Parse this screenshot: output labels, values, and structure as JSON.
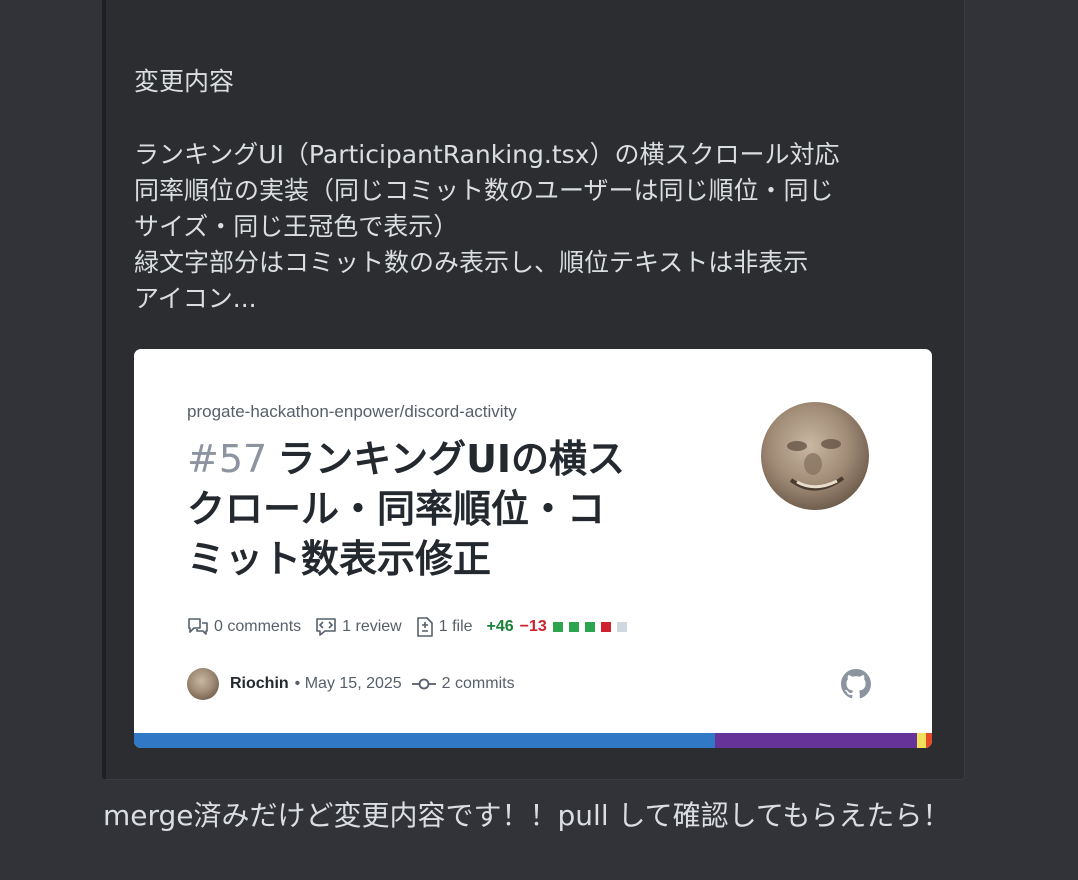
{
  "embed": {
    "section_title": "変更内容",
    "description_lines": [
      "ランキングUI（ParticipantRanking.tsx）の横スクロール対応",
      "同率順位の実装（同じコミット数のユーザーは同じ順位・同じ",
      "サイズ・同じ王冠色で表示）",
      "緑文字部分はコミット数のみ表示し、順位テキストは非表示",
      "アイコン..."
    ]
  },
  "card": {
    "repo": "progate-hackathon-enpower/discord-activity",
    "pr_number": "#57",
    "pr_title_lines": [
      "ランキングUIの横ス",
      "クロール・同率順位・コ",
      "ミット数表示修正"
    ],
    "comments": "0 comments",
    "reviews": "1 review",
    "files": "1 file",
    "additions": "+46",
    "deletions": "−13",
    "diff_squares": [
      "#2da44e",
      "#2da44e",
      "#2da44e",
      "#cf222e",
      "#d0d7de"
    ],
    "author": "Riochin",
    "date": "• May 15, 2025",
    "commits": "2 commits",
    "icons": {
      "comments": "comment-discussion-icon",
      "reviews": "code-review-icon",
      "files": "file-diff-icon",
      "commits": "git-commit-icon",
      "brand": "github-icon"
    },
    "language_bar": [
      {
        "color": "#3178c6",
        "fraction": 0.728
      },
      {
        "color": "#663399",
        "fraction": 0.253
      },
      {
        "color": "#f1e05a",
        "fraction": 0.011
      },
      {
        "color": "#e34c26",
        "fraction": 0.008
      }
    ]
  },
  "message": {
    "text": "merge済みだけど変更内容です！！pull して確認してもらえたら！"
  }
}
